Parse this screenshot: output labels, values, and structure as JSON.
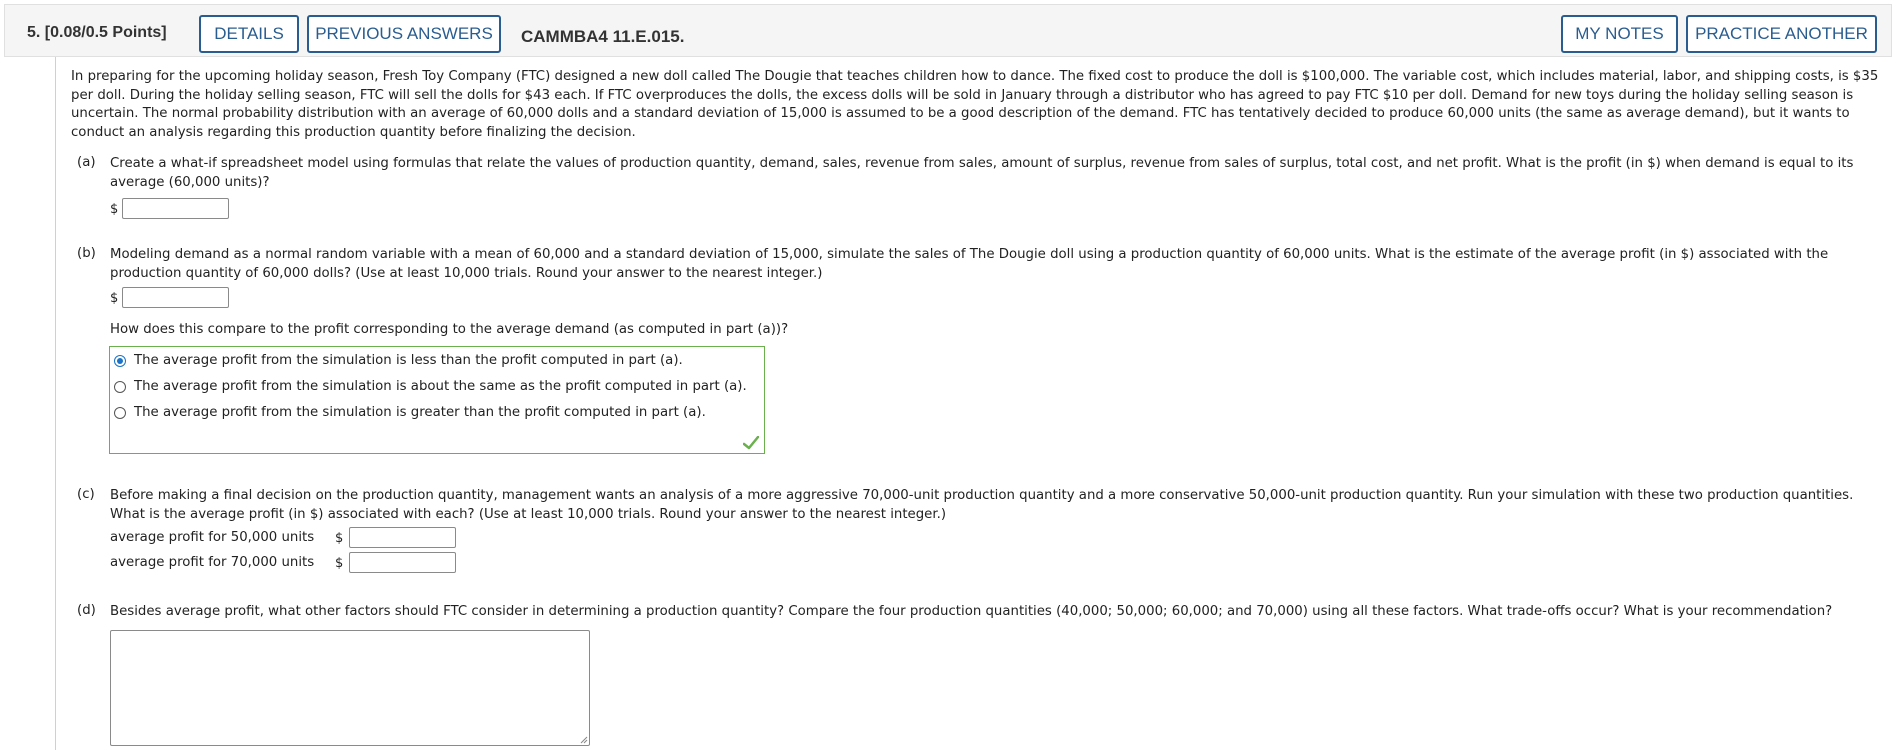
{
  "header": {
    "question_number": "5.",
    "points": "[0.08/0.5 Points]",
    "details_label": "DETAILS",
    "previous_answers_label": "PREVIOUS ANSWERS",
    "question_code": "CAMMBA4 11.E.015.",
    "my_notes_label": "MY NOTES",
    "practice_another_label": "PRACTICE ANOTHER"
  },
  "intro": "In preparing for the upcoming holiday season, Fresh Toy Company (FTC) designed a new doll called The Dougie that teaches children how to dance. The fixed cost to produce the doll is $100,000. The variable cost, which includes material, labor, and shipping costs, is $35 per doll. During the holiday selling season, FTC will sell the dolls for $43 each. If FTC overproduces the dolls, the excess dolls will be sold in January through a distributor who has agreed to pay FTC $10 per doll. Demand for new toys during the holiday selling season is uncertain. The normal probability distribution with an average of 60,000 dolls and a standard deviation of 15,000 is assumed to be a good description of the demand. FTC has tentatively decided to produce 60,000 units (the same as average demand), but it wants to conduct an analysis regarding this production quantity before finalizing the decision.",
  "part_a": {
    "label": "(a)",
    "text": "Create a what-if spreadsheet model using formulas that relate the values of production quantity, demand, sales, revenue from sales, amount of surplus, revenue from sales of surplus, total cost, and net profit. What is the profit (in $) when demand is equal to its average (60,000 units)?",
    "currency": "$",
    "answer": ""
  },
  "part_b": {
    "label": "(b)",
    "text": "Modeling demand as a normal random variable with a mean of 60,000 and a standard deviation of 15,000, simulate the sales of The Dougie doll using a production quantity of 60,000 units. What is the estimate of the average profit (in $) associated with the production quantity of 60,000 dolls? (Use at least 10,000 trials. Round your answer to the nearest integer.)",
    "currency": "$",
    "answer": "",
    "compare_question": "How does this compare to the profit corresponding to the average demand (as computed in part (a))?",
    "choices": [
      {
        "text": "The average profit from the simulation is less than the profit computed in part (a).",
        "selected": true
      },
      {
        "text": "The average profit from the simulation is about the same as the profit computed in part (a).",
        "selected": false
      },
      {
        "text": "The average profit from the simulation is greater than the profit computed in part (a).",
        "selected": false
      }
    ],
    "result_icon": "checkmark-icon",
    "correct_color": "#6ab04c"
  },
  "part_c": {
    "label": "(c)",
    "text": "Before making a final decision on the production quantity, management wants an analysis of a more aggressive 70,000-unit production quantity and a more conservative 50,000-unit production quantity. Run your simulation with these two production quantities. What is the average profit (in $) associated with each? (Use at least 10,000 trials. Round your answer to the nearest integer.)",
    "rows": [
      {
        "label": "average profit for 50,000 units",
        "currency": "$",
        "answer": ""
      },
      {
        "label": "average profit for 70,000 units",
        "currency": "$",
        "answer": ""
      }
    ]
  },
  "part_d": {
    "label": "(d)",
    "text": "Besides average profit, what other factors should FTC consider in determining a production quantity? Compare the four production quantities (40,000; 50,000; 60,000; and 70,000) using all these factors. What trade-offs occur? What is your recommendation?",
    "answer": ""
  },
  "colors": {
    "accent": "#2a5d8f",
    "radio_selected": "#1a73c8"
  }
}
